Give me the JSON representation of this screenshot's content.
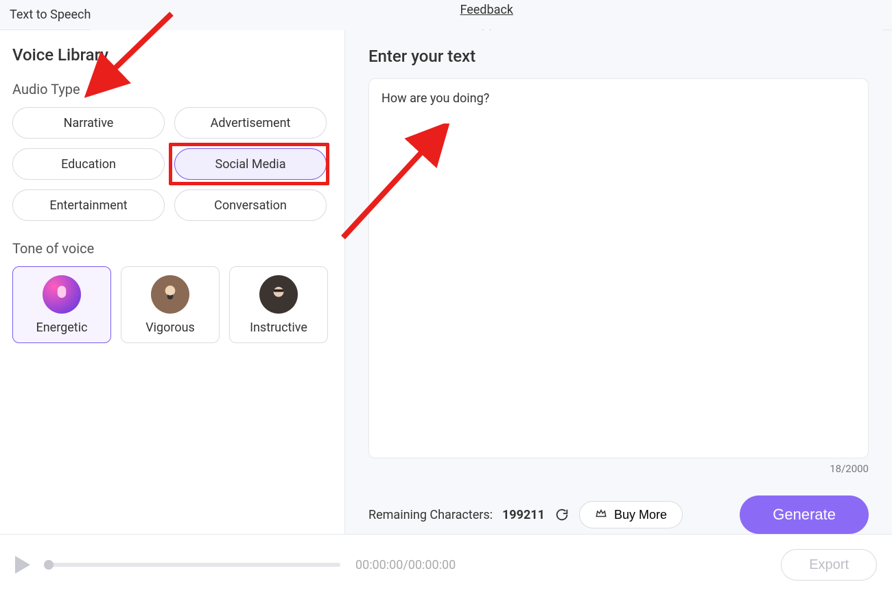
{
  "header": {
    "title": "Text to Speech",
    "feedback": "Feedback",
    "close_glyph": "✕"
  },
  "left": {
    "library_title": "Voice Library",
    "audio_type_label": "Audio Type",
    "audio_types": [
      "Narrative",
      "Advertisement",
      "Education",
      "Social Media",
      "Entertainment",
      "Conversation"
    ],
    "audio_type_selected_index": 3,
    "tone_label": "Tone of voice",
    "tones": [
      {
        "label": "Energetic"
      },
      {
        "label": "Vigorous"
      },
      {
        "label": "Instructive"
      }
    ],
    "tone_selected_index": 0
  },
  "right": {
    "enter_text_label": "Enter your text",
    "text_value": "How are you doing?",
    "counter": "18/2000",
    "remain_label": "Remaining Characters: ",
    "remain_value": "199211",
    "buy_more": "Buy More",
    "generate": "Generate"
  },
  "player": {
    "timecode": "00:00:00/00:00:00",
    "export": "Export"
  },
  "annotations": {
    "highlight_pill_index": 3
  }
}
